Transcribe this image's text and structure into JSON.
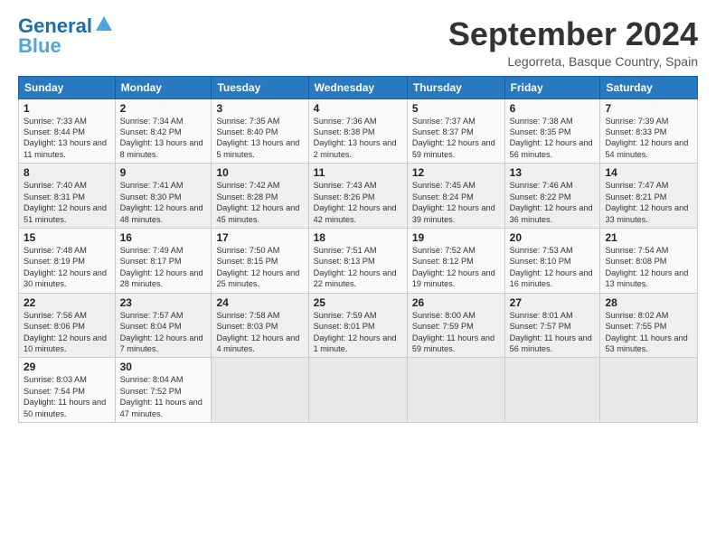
{
  "header": {
    "logo_general": "General",
    "logo_blue": "Blue",
    "title": "September 2024",
    "subtitle": "Legorreta, Basque Country, Spain"
  },
  "calendar": {
    "days_of_week": [
      "Sunday",
      "Monday",
      "Tuesday",
      "Wednesday",
      "Thursday",
      "Friday",
      "Saturday"
    ],
    "weeks": [
      [
        null,
        null,
        null,
        null,
        null,
        null,
        null
      ]
    ]
  },
  "cells": [
    {
      "day": 1,
      "sunrise": "Sunrise: 7:33 AM",
      "sunset": "Sunset: 8:44 PM",
      "daylight": "Daylight: 13 hours and 11 minutes."
    },
    {
      "day": 2,
      "sunrise": "Sunrise: 7:34 AM",
      "sunset": "Sunset: 8:42 PM",
      "daylight": "Daylight: 13 hours and 8 minutes."
    },
    {
      "day": 3,
      "sunrise": "Sunrise: 7:35 AM",
      "sunset": "Sunset: 8:40 PM",
      "daylight": "Daylight: 13 hours and 5 minutes."
    },
    {
      "day": 4,
      "sunrise": "Sunrise: 7:36 AM",
      "sunset": "Sunset: 8:38 PM",
      "daylight": "Daylight: 13 hours and 2 minutes."
    },
    {
      "day": 5,
      "sunrise": "Sunrise: 7:37 AM",
      "sunset": "Sunset: 8:37 PM",
      "daylight": "Daylight: 12 hours and 59 minutes."
    },
    {
      "day": 6,
      "sunrise": "Sunrise: 7:38 AM",
      "sunset": "Sunset: 8:35 PM",
      "daylight": "Daylight: 12 hours and 56 minutes."
    },
    {
      "day": 7,
      "sunrise": "Sunrise: 7:39 AM",
      "sunset": "Sunset: 8:33 PM",
      "daylight": "Daylight: 12 hours and 54 minutes."
    },
    {
      "day": 8,
      "sunrise": "Sunrise: 7:40 AM",
      "sunset": "Sunset: 8:31 PM",
      "daylight": "Daylight: 12 hours and 51 minutes."
    },
    {
      "day": 9,
      "sunrise": "Sunrise: 7:41 AM",
      "sunset": "Sunset: 8:30 PM",
      "daylight": "Daylight: 12 hours and 48 minutes."
    },
    {
      "day": 10,
      "sunrise": "Sunrise: 7:42 AM",
      "sunset": "Sunset: 8:28 PM",
      "daylight": "Daylight: 12 hours and 45 minutes."
    },
    {
      "day": 11,
      "sunrise": "Sunrise: 7:43 AM",
      "sunset": "Sunset: 8:26 PM",
      "daylight": "Daylight: 12 hours and 42 minutes."
    },
    {
      "day": 12,
      "sunrise": "Sunrise: 7:45 AM",
      "sunset": "Sunset: 8:24 PM",
      "daylight": "Daylight: 12 hours and 39 minutes."
    },
    {
      "day": 13,
      "sunrise": "Sunrise: 7:46 AM",
      "sunset": "Sunset: 8:22 PM",
      "daylight": "Daylight: 12 hours and 36 minutes."
    },
    {
      "day": 14,
      "sunrise": "Sunrise: 7:47 AM",
      "sunset": "Sunset: 8:21 PM",
      "daylight": "Daylight: 12 hours and 33 minutes."
    },
    {
      "day": 15,
      "sunrise": "Sunrise: 7:48 AM",
      "sunset": "Sunset: 8:19 PM",
      "daylight": "Daylight: 12 hours and 30 minutes."
    },
    {
      "day": 16,
      "sunrise": "Sunrise: 7:49 AM",
      "sunset": "Sunset: 8:17 PM",
      "daylight": "Daylight: 12 hours and 28 minutes."
    },
    {
      "day": 17,
      "sunrise": "Sunrise: 7:50 AM",
      "sunset": "Sunset: 8:15 PM",
      "daylight": "Daylight: 12 hours and 25 minutes."
    },
    {
      "day": 18,
      "sunrise": "Sunrise: 7:51 AM",
      "sunset": "Sunset: 8:13 PM",
      "daylight": "Daylight: 12 hours and 22 minutes."
    },
    {
      "day": 19,
      "sunrise": "Sunrise: 7:52 AM",
      "sunset": "Sunset: 8:12 PM",
      "daylight": "Daylight: 12 hours and 19 minutes."
    },
    {
      "day": 20,
      "sunrise": "Sunrise: 7:53 AM",
      "sunset": "Sunset: 8:10 PM",
      "daylight": "Daylight: 12 hours and 16 minutes."
    },
    {
      "day": 21,
      "sunrise": "Sunrise: 7:54 AM",
      "sunset": "Sunset: 8:08 PM",
      "daylight": "Daylight: 12 hours and 13 minutes."
    },
    {
      "day": 22,
      "sunrise": "Sunrise: 7:56 AM",
      "sunset": "Sunset: 8:06 PM",
      "daylight": "Daylight: 12 hours and 10 minutes."
    },
    {
      "day": 23,
      "sunrise": "Sunrise: 7:57 AM",
      "sunset": "Sunset: 8:04 PM",
      "daylight": "Daylight: 12 hours and 7 minutes."
    },
    {
      "day": 24,
      "sunrise": "Sunrise: 7:58 AM",
      "sunset": "Sunset: 8:03 PM",
      "daylight": "Daylight: 12 hours and 4 minutes."
    },
    {
      "day": 25,
      "sunrise": "Sunrise: 7:59 AM",
      "sunset": "Sunset: 8:01 PM",
      "daylight": "Daylight: 12 hours and 1 minute."
    },
    {
      "day": 26,
      "sunrise": "Sunrise: 8:00 AM",
      "sunset": "Sunset: 7:59 PM",
      "daylight": "Daylight: 11 hours and 59 minutes."
    },
    {
      "day": 27,
      "sunrise": "Sunrise: 8:01 AM",
      "sunset": "Sunset: 7:57 PM",
      "daylight": "Daylight: 11 hours and 56 minutes."
    },
    {
      "day": 28,
      "sunrise": "Sunrise: 8:02 AM",
      "sunset": "Sunset: 7:55 PM",
      "daylight": "Daylight: 11 hours and 53 minutes."
    },
    {
      "day": 29,
      "sunrise": "Sunrise: 8:03 AM",
      "sunset": "Sunset: 7:54 PM",
      "daylight": "Daylight: 11 hours and 50 minutes."
    },
    {
      "day": 30,
      "sunrise": "Sunrise: 8:04 AM",
      "sunset": "Sunset: 7:52 PM",
      "daylight": "Daylight: 11 hours and 47 minutes."
    }
  ]
}
